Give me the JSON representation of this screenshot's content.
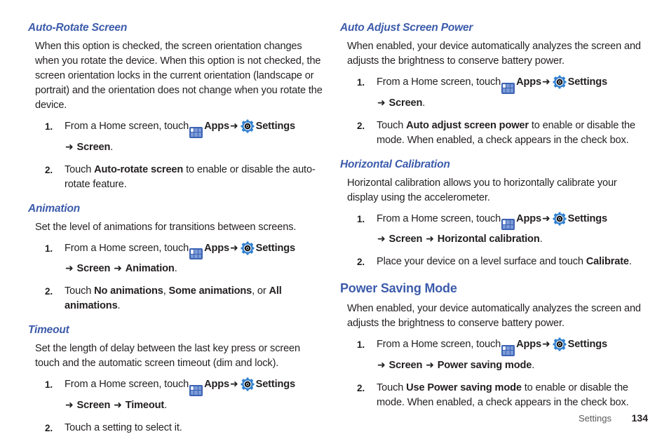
{
  "page": {
    "footer_label": "Settings",
    "page_number": "134",
    "heading_color": "#3c5bab",
    "text_color": "#231f20",
    "apps_icon_color": "#3c63b4",
    "gear_icon_color": "#2f7fd0"
  },
  "icons": {
    "apps": "apps-grid-icon",
    "gear": "settings-gear-icon",
    "arrow": "➜"
  },
  "left_column": {
    "sections": [
      {
        "heading": "Auto-Rotate Screen",
        "heading_level": "sub",
        "body": "When this option is checked, the screen orientation changes when you rotate the device. When this option is not checked, the screen orientation locks in the current orientation (landscape or portrait) and the orientation does not change when you rotate the device.",
        "steps": [
          {
            "num": "1.",
            "line1_pre": "From a Home screen, touch",
            "line1_apps": "Apps",
            "line1_settings": "Settings",
            "line2": "Screen",
            "line2_suffix": "."
          },
          {
            "num": "2.",
            "pre": "Touch ",
            "bold": "Auto-rotate screen",
            "post": " to enable or disable the auto-rotate feature."
          }
        ]
      },
      {
        "heading": "Animation",
        "heading_level": "sub",
        "body": "Set the level of animations for transitions between screens.",
        "steps": [
          {
            "num": "1.",
            "line1_pre": "From a Home screen, touch",
            "line1_apps": "Apps",
            "line1_settings": "Settings",
            "line2": "Screen",
            "line2b": "Animation",
            "line2_suffix": "."
          },
          {
            "num": "2.",
            "pre": "Touch ",
            "bold": "No animations",
            "mid1": ", ",
            "bold2": "Some animations",
            "mid2": ", or ",
            "bold3": "All animations",
            "post": "."
          }
        ]
      },
      {
        "heading": "Timeout",
        "heading_level": "sub",
        "body": "Set the length of delay between the last key press or screen touch and the automatic screen timeout (dim and lock).",
        "steps": [
          {
            "num": "1.",
            "line1_pre": "From a Home screen, touch",
            "line1_apps": "Apps",
            "line1_settings": "Settings",
            "line2": "Screen",
            "line2b": "Timeout",
            "line2_suffix": "."
          },
          {
            "num": "2.",
            "pre": "Touch a setting to select it.",
            "bold": "",
            "post": ""
          }
        ]
      }
    ]
  },
  "right_column": {
    "sections": [
      {
        "heading": "Auto Adjust Screen Power",
        "heading_level": "sub",
        "body": "When enabled, your device automatically analyzes the screen and adjusts the brightness to conserve battery power.",
        "steps": [
          {
            "num": "1.",
            "line1_pre": "From a Home screen, touch",
            "line1_apps": "Apps",
            "line1_settings": "Settings",
            "line2": "Screen",
            "line2_suffix": "."
          },
          {
            "num": "2.",
            "pre": "Touch ",
            "bold": "Auto adjust screen power",
            "post": " to enable or disable the mode. When enabled, a check appears in the check box."
          }
        ]
      },
      {
        "heading": "Horizontal Calibration",
        "heading_level": "sub",
        "body": "Horizontal calibration allows you to horizontally calibrate your display using the accelerometer.",
        "steps": [
          {
            "num": "1.",
            "line1_pre": "From a Home screen, touch",
            "line1_apps": "Apps",
            "line1_settings": "Settings",
            "line2": "Screen",
            "line2b": "Horizontal calibration",
            "line2_suffix": "."
          },
          {
            "num": "2.",
            "pre": "Place your device on a level surface and touch ",
            "bold": "Calibrate",
            "post": "."
          }
        ]
      },
      {
        "heading": "Power Saving Mode",
        "heading_level": "section",
        "body": "When enabled, your device automatically analyzes the screen and adjusts the brightness to conserve battery power.",
        "steps": [
          {
            "num": "1.",
            "line1_pre": "From a Home screen, touch",
            "line1_apps": "Apps",
            "line1_settings": "Settings",
            "line2": "Screen",
            "line2b": "Power saving mode",
            "line2_suffix": "."
          },
          {
            "num": "2.",
            "pre": "Touch ",
            "bold": "Use Power saving mode",
            "post": " to enable or disable the mode. When enabled, a check appears in the check box."
          }
        ]
      }
    ]
  }
}
